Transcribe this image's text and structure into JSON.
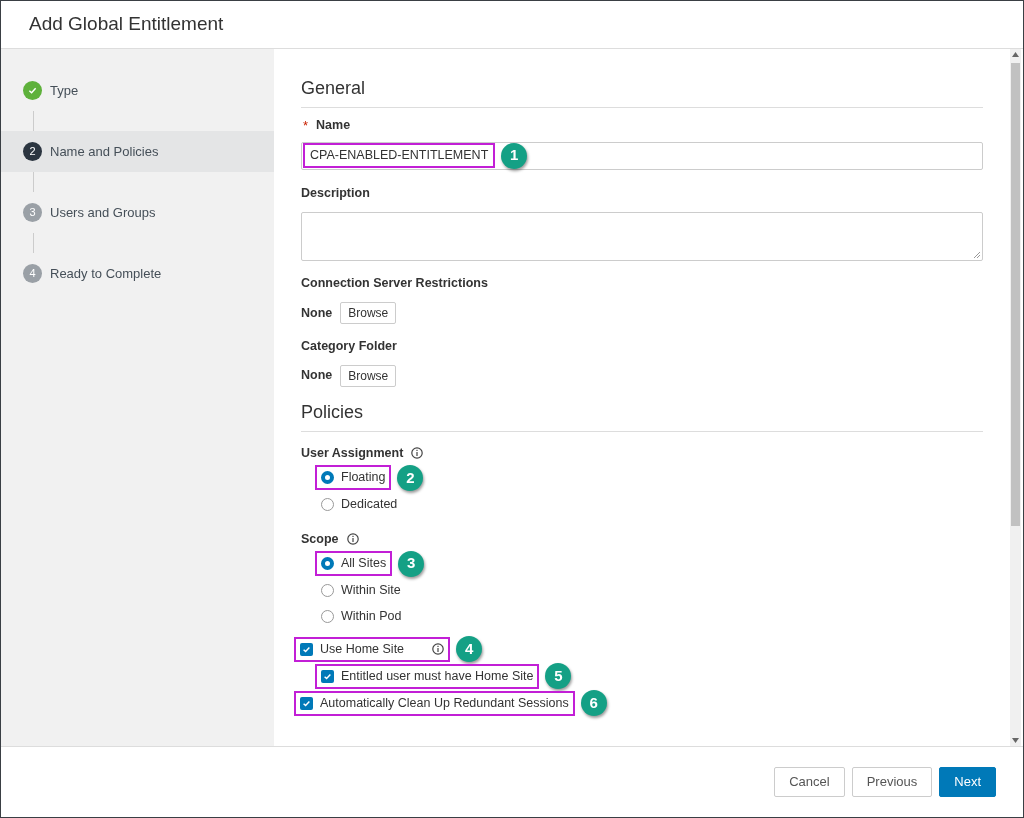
{
  "dialog": {
    "title": "Add Global Entitlement"
  },
  "steps": [
    {
      "label": "Type",
      "completed": true,
      "selected": false
    },
    {
      "number": "2",
      "label": "Name and Policies",
      "completed": false,
      "selected": true
    },
    {
      "number": "3",
      "label": "Users and Groups",
      "completed": false,
      "selected": false
    },
    {
      "number": "4",
      "label": "Ready to Complete",
      "completed": false,
      "selected": false
    }
  ],
  "general": {
    "heading": "General",
    "name": {
      "label": "Name",
      "required_mark": "*",
      "value": "CPA-ENABLED-ENTITLEMENT",
      "callout": "1"
    },
    "description": {
      "label": "Description"
    },
    "pickers": [
      {
        "label": "Connection Server Restrictions",
        "value": "None",
        "button": "Browse"
      },
      {
        "label": "Category Folder",
        "value": "None",
        "button": "Browse"
      }
    ]
  },
  "policies": {
    "heading": "Policies",
    "radio_groups": [
      {
        "label": "User Assignment",
        "info": true,
        "options": [
          {
            "label": "Floating",
            "selected": true,
            "callout": "2"
          },
          {
            "label": "Dedicated",
            "selected": false
          }
        ]
      },
      {
        "label": "Scope",
        "info": true,
        "options": [
          {
            "label": "All Sites",
            "selected": true,
            "callout": "3"
          },
          {
            "label": "Within Site",
            "selected": false
          },
          {
            "label": "Within Pod",
            "selected": false
          }
        ]
      }
    ],
    "checkboxes": [
      {
        "label": "Use Home Site",
        "checked": true,
        "info": true,
        "callout": "4",
        "children": [
          {
            "label": "Entitled user must have Home Site",
            "checked": true,
            "callout": "5"
          }
        ]
      },
      {
        "label": "Automatically Clean Up Redundant Sessions",
        "checked": true,
        "callout": "6"
      }
    ]
  },
  "footer": {
    "buttons": [
      {
        "label": "Cancel",
        "kind": "secondary"
      },
      {
        "label": "Previous",
        "kind": "secondary"
      },
      {
        "label": "Next",
        "kind": "primary"
      }
    ]
  }
}
